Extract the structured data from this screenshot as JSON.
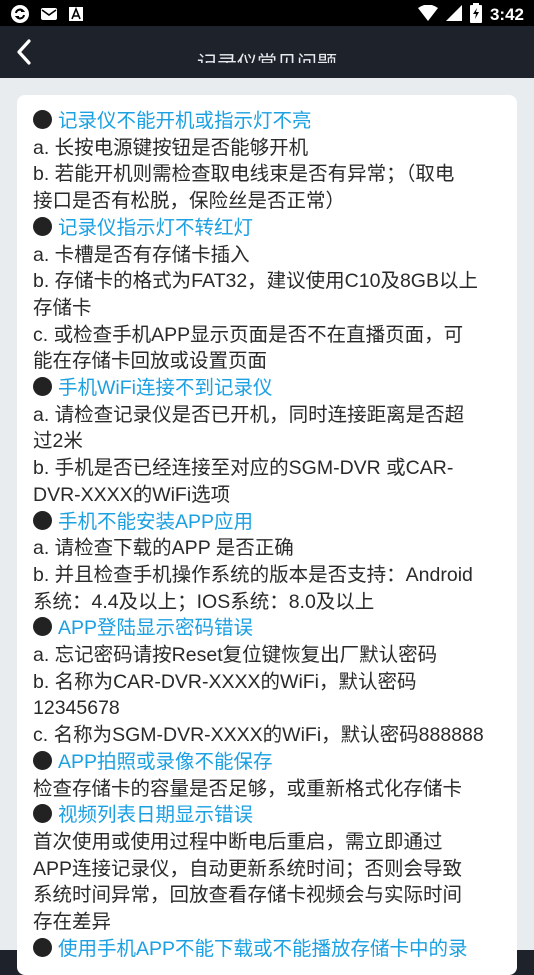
{
  "status_bar": {
    "time": "3:42",
    "icons": [
      "sync-icon",
      "mail-icon",
      "font-a-icon",
      "wifi-icon",
      "cellular-signal-icon",
      "battery-charging-icon"
    ]
  },
  "app_bar": {
    "title": "记录仪常见问题",
    "back_icon": "chevron-left-icon"
  },
  "colors": {
    "question": "#1ba0e2",
    "answer": "#2a2a2a",
    "header_bg": "#1e232b",
    "page_bg": "#e9ecef",
    "card_bg": "#ffffff"
  },
  "faq": [
    {
      "question": "记录仪不能开机或指示灯不亮",
      "answer_lines": [
        "a. 长按电源键按钮是否能够开机",
        "b. 若能开机则需检查取电线束是否有异常；（取电",
        "接口是否有松脱，保险丝是否正常）"
      ]
    },
    {
      "question": "记录仪指示灯不转红灯",
      "answer_lines": [
        "a. 卡槽是否有存储卡插入",
        "b. 存储卡的格式为FAT32，建议使用C10及8GB以上",
        "存储卡",
        "c. 或检查手机APP显示页面是否不在直播页面，可",
        "能在存储卡回放或设置页面"
      ]
    },
    {
      "question": "手机WiFi连接不到记录仪",
      "answer_lines": [
        "a. 请检查记录仪是否已开机，同时连接距离是否超",
        "过2米",
        "b. 手机是否已经连接至对应的SGM-DVR 或CAR-",
        "DVR-XXXX的WiFi选项"
      ]
    },
    {
      "question": "手机不能安装APP应用",
      "answer_lines": [
        "a. 请检查下载的APP 是否正确",
        "b. 并且检查手机操作系统的版本是否支持：Android",
        "系统：4.4及以上；IOS系统：8.0及以上"
      ]
    },
    {
      "question": "APP登陆显示密码错误",
      "answer_lines": [
        "a. 忘记密码请按Reset复位键恢复出厂默认密码",
        "b. 名称为CAR-DVR-XXXX的WiFi，默认密码",
        "12345678",
        "c. 名称为SGM-DVR-XXXX的WiFi，默认密码888888"
      ]
    },
    {
      "question": "APP拍照或录像不能保存",
      "answer_lines": [
        "检查存储卡的容量是否足够，或重新格式化存储卡"
      ]
    },
    {
      "question": "视频列表日期显示错误",
      "answer_lines": [
        "首次使用或使用过程中断电后重启，需立即通过",
        "APP连接记录仪，自动更新系统时间；否则会导致",
        "系统时间异常，回放查看存储卡视频会与实际时间",
        "存在差异"
      ]
    },
    {
      "question": "使用手机APP不能下载或不能播放存储卡中的录",
      "answer_lines": []
    }
  ]
}
